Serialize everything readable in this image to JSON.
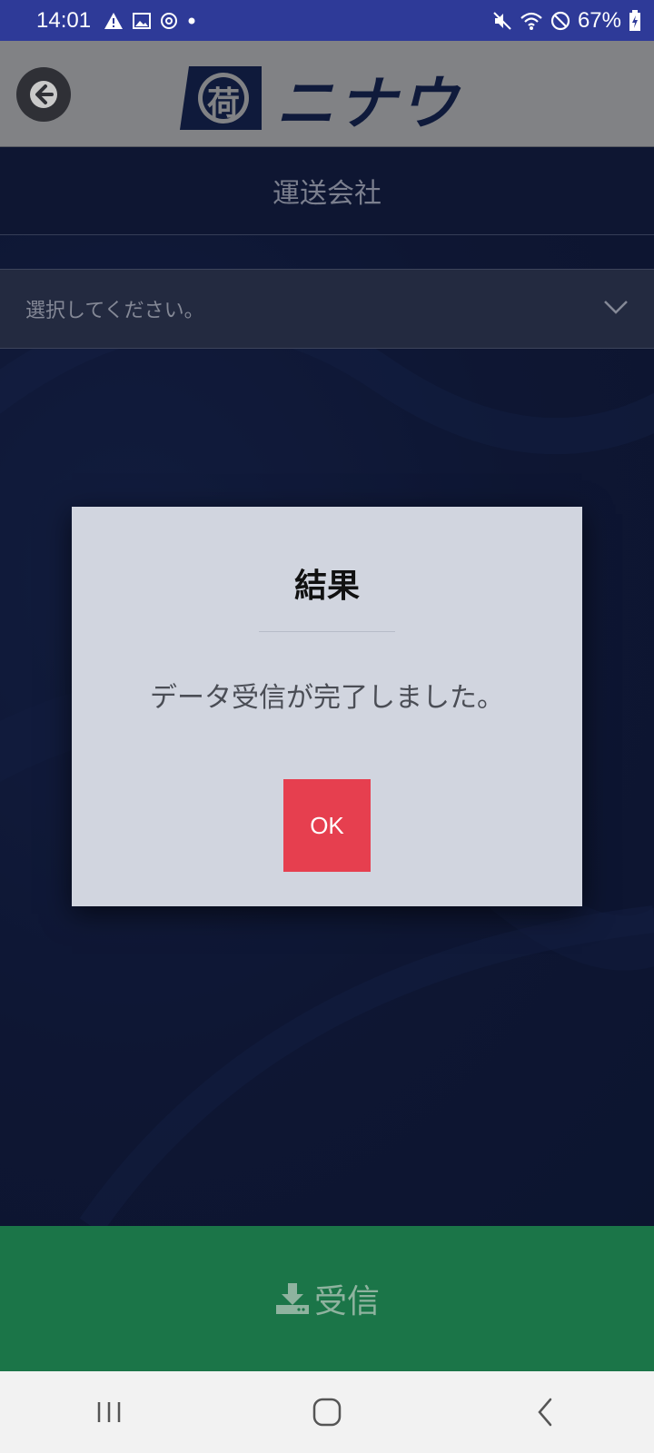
{
  "status_bar": {
    "time": "14:01",
    "battery": "67%",
    "icons": [
      "warning-icon",
      "image-icon",
      "sync-icon",
      "dot-icon",
      "mute-icon",
      "wifi-icon",
      "no-disturb-icon",
      "battery-icon"
    ]
  },
  "app_bar": {
    "logo_text": "ニナウ",
    "logo_mark_char": "荷"
  },
  "section": {
    "title": "運送会社"
  },
  "select": {
    "placeholder": "選択してください。"
  },
  "dialog": {
    "title": "結果",
    "message": "データ受信が完了しました。",
    "ok_label": "OK"
  },
  "receive_button": {
    "label": "受信"
  },
  "colors": {
    "status_bar": "#2e3a98",
    "app_bar": "#818285",
    "background": "#0f1a3b",
    "ok_button": "#e63f4f",
    "receive_button": "#1b7548"
  }
}
